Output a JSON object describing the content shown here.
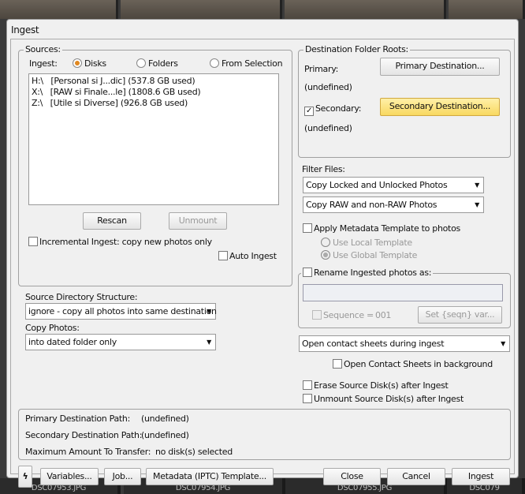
{
  "window": {
    "title": "Ingest"
  },
  "sources": {
    "legend": "Sources:",
    "ingest_label": "Ingest:",
    "radio_disks": "Disks",
    "radio_folders": "Folders",
    "radio_selection": "From Selection",
    "selected": "Disks",
    "disks": [
      "H:\\   [Personal si J...dic] (537.8 GB used)",
      "X:\\   [RAW si Finale...le] (1808.6 GB used)",
      "Z:\\   [Utile si Diverse] (926.8 GB used)"
    ],
    "rescan": "Rescan",
    "unmount": "Unmount",
    "incremental": "Incremental Ingest: copy new photos only",
    "incremental_checked": false,
    "auto_ingest": "Auto Ingest",
    "auto_ingest_checked": false
  },
  "structure": {
    "label": "Source Directory Structure:",
    "value": "ignore - copy all photos into same destination"
  },
  "copy": {
    "label": "Copy Photos:",
    "value": "into dated folder only"
  },
  "destination": {
    "legend": "Destination Folder Roots:",
    "primary_label": "Primary:",
    "primary_button": "Primary Destination...",
    "primary_value": "(undefined)",
    "secondary_label": "Secondary:",
    "secondary_checked": true,
    "secondary_button": "Secondary Destination...",
    "secondary_value": "(undefined)"
  },
  "filter": {
    "label": "Filter Files:",
    "locked": "Copy Locked and Unlocked Photos",
    "raw": "Copy RAW and non-RAW Photos"
  },
  "metadata": {
    "apply": "Apply Metadata Template to photos",
    "local": "Use Local Template",
    "global": "Use Global Template",
    "selected": "Use Global Template"
  },
  "rename": {
    "label": "Rename Ingested photos as:",
    "input_value": "",
    "sequence_label": "Sequence =",
    "sequence_value": "001",
    "set_button": "Set {seqn} var..."
  },
  "contact": {
    "value": "Open contact sheets during ingest",
    "background": "Open Contact Sheets in background"
  },
  "erase": "Erase Source Disk(s) after Ingest",
  "unmount_after": "Unmount Source Disk(s) after Ingest",
  "summary": {
    "primary_label": "Primary Destination Path:",
    "primary_value": "(undefined)",
    "secondary_label": "Secondary Destination Path:",
    "secondary_value": "(undefined)",
    "max_label": "Maximum Amount To Transfer:",
    "max_value": "no disk(s) selected"
  },
  "footer": {
    "variables": "Variables...",
    "job": "Job...",
    "metadata": "Metadata (IPTC) Template...",
    "close": "Close",
    "cancel": "Cancel",
    "ingest": "Ingest"
  },
  "background_files": [
    "DSC07953.JPG",
    "DSC07954.JPG",
    "DSC07955.JPG",
    "DSC079"
  ]
}
